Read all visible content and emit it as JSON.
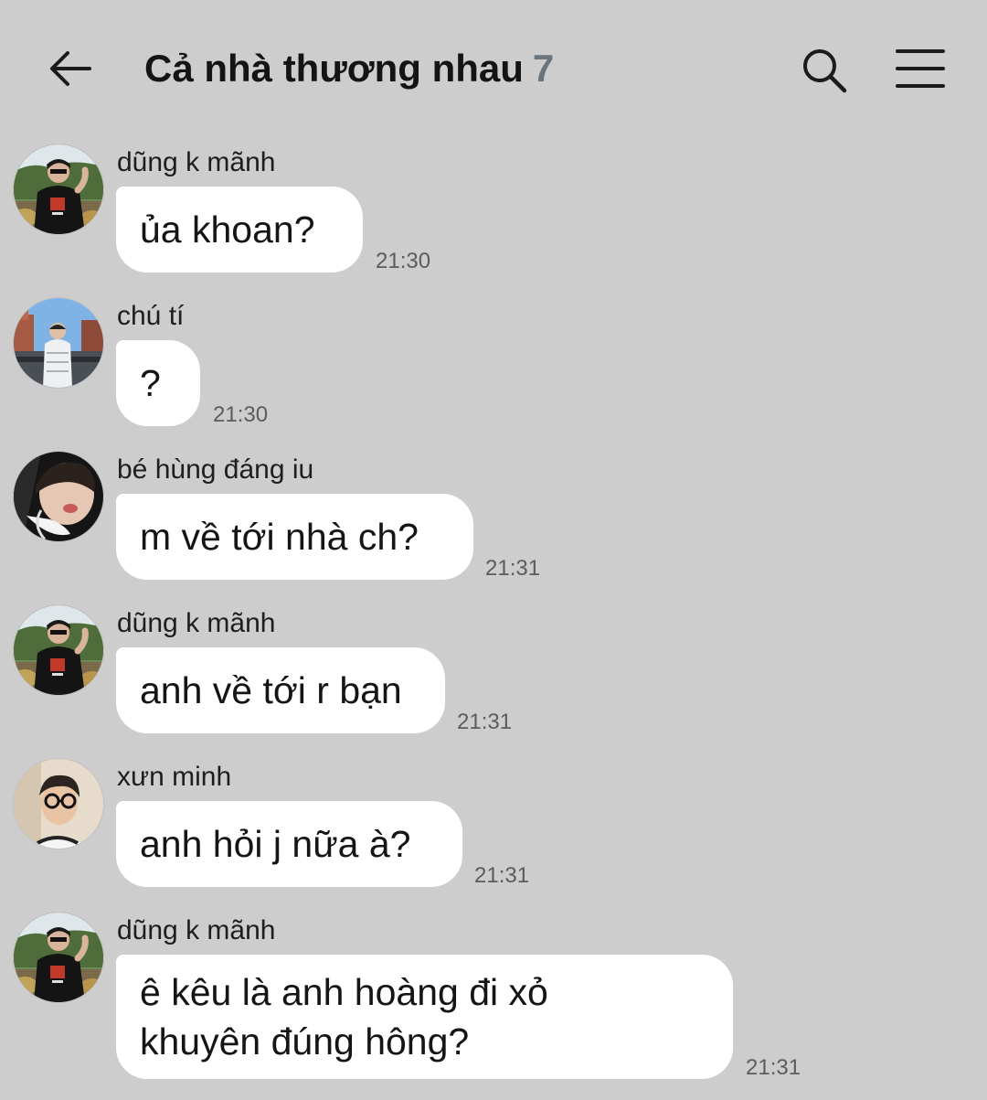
{
  "header": {
    "back_icon": "arrow-left-icon",
    "title": "Cả nhà thương nhau",
    "member_count": "7",
    "search_icon": "search-icon",
    "menu_icon": "hamburger-menu-icon"
  },
  "messages": [
    {
      "sender": "dũng k mãnh",
      "lines": [
        "ủa khoan?"
      ],
      "time": "21:30",
      "avatar": "avatar-dung"
    },
    {
      "sender": "chú tí",
      "lines": [
        "?"
      ],
      "time": "21:30",
      "avatar": "avatar-ti"
    },
    {
      "sender": "bé hùng đáng iu",
      "lines": [
        "m về tới nhà ch?"
      ],
      "time": "21:31",
      "avatar": "avatar-hung"
    },
    {
      "sender": "dũng k mãnh",
      "lines": [
        "anh về tới r bạn"
      ],
      "time": "21:31",
      "avatar": "avatar-dung"
    },
    {
      "sender": "xưn minh",
      "lines": [
        "anh hỏi j nữa à?"
      ],
      "time": "21:31",
      "avatar": "avatar-minh"
    },
    {
      "sender": "dũng k mãnh",
      "lines": [
        "ê kêu là anh hoàng đi xỏ",
        "khuyên đúng hông?"
      ],
      "time": "21:31",
      "avatar": "avatar-dung"
    }
  ]
}
